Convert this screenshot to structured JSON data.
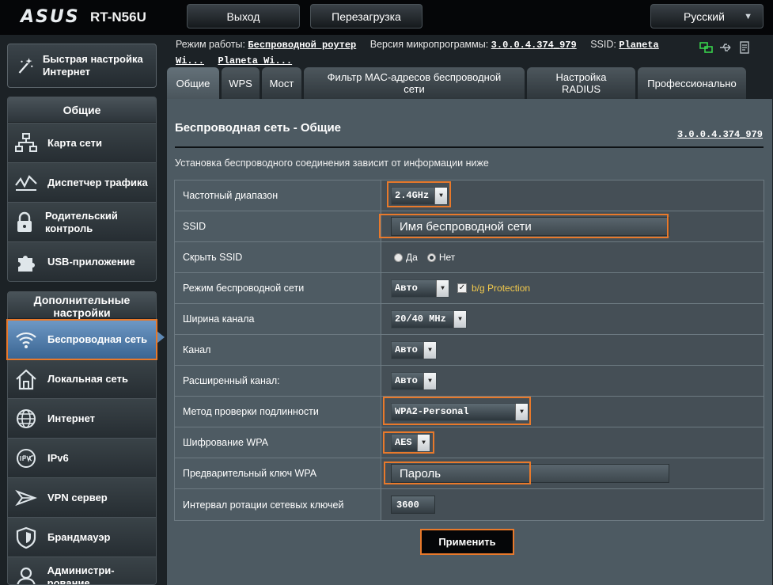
{
  "brand": {
    "logo": "ASUS",
    "model": "RT-N56U"
  },
  "header": {
    "logout": "Выход",
    "reboot": "Перезагрузка",
    "language": "Русский"
  },
  "status": {
    "mode_label": "Режим работы:",
    "mode_value": "Беспроводной роутер",
    "fw_label": "Версия микропрограммы:",
    "fw_value": "3.0.0.4.374_979",
    "ssid_label": "SSID:",
    "ssid_value1": "Planeta Wi...",
    "ssid_value2": "Planeta Wi..."
  },
  "sidebar": {
    "quick_setup": "Быстрая настройка Интернет",
    "general_header": "Общие",
    "general_items": [
      {
        "label": "Карта сети",
        "icon": "network-map-icon"
      },
      {
        "label": "Диспетчер трафика",
        "icon": "traffic-manager-icon"
      },
      {
        "label": "Родительский контроль",
        "icon": "parental-control-icon"
      },
      {
        "label": "USB-приложение",
        "icon": "usb-app-icon"
      }
    ],
    "advanced_header": "Дополнительные настройки",
    "advanced_items": [
      {
        "label": "Беспроводная сеть",
        "icon": "wireless-icon",
        "active": true
      },
      {
        "label": "Локальная сеть",
        "icon": "lan-icon"
      },
      {
        "label": "Интернет",
        "icon": "internet-globe-icon"
      },
      {
        "label": "IPv6",
        "icon": "ipv6-icon"
      },
      {
        "label": "VPN сервер",
        "icon": "vpn-icon"
      },
      {
        "label": "Брандмауэр",
        "icon": "firewall-icon"
      },
      {
        "label": "Администри-рование",
        "icon": "admin-icon"
      }
    ]
  },
  "tabs": [
    {
      "label": "Общие",
      "active": true
    },
    {
      "label": "WPS"
    },
    {
      "label": "Мост"
    },
    {
      "label": "Фильтр MAC-адресов беспроводной сети"
    },
    {
      "label": "Настройка RADIUS"
    },
    {
      "label": "Профессионально"
    }
  ],
  "page": {
    "title": "Беспроводная сеть - Общие",
    "fw_link": "3.0.0.4.374_979",
    "description": "Установка беспроводного соединения зависит от информации ниже"
  },
  "form": {
    "band_label": "Частотный диапазон",
    "band_value": "2.4GHz",
    "ssid_label": "SSID",
    "ssid_value": "Имя беспроводной сети",
    "hide_label": "Скрыть SSID",
    "hide_yes": "Да",
    "hide_no": "Нет",
    "mode_label": "Режим беспроводной сети",
    "mode_value": "Авто",
    "protection_label": "b/g Protection",
    "width_label": "Ширина канала",
    "width_value": "20/40 MHz",
    "channel_label": "Канал",
    "channel_value": "Авто",
    "ext_label": "Расширенный канал:",
    "ext_value": "Авто",
    "auth_label": "Метод проверки подлинности",
    "auth_value": "WPA2-Personal",
    "enc_label": "Шифрование WPA",
    "enc_value": "AES",
    "key_label": "Предварительный ключ WPA",
    "key_value": "Пароль",
    "rot_label": "Интервал ротации сетевых ключей",
    "rot_value": "3600"
  },
  "apply_label": "Применить",
  "colors": {
    "highlight": "#e8792b",
    "active_nav": "#4f7cab",
    "protection_text": "#f2c94c"
  }
}
